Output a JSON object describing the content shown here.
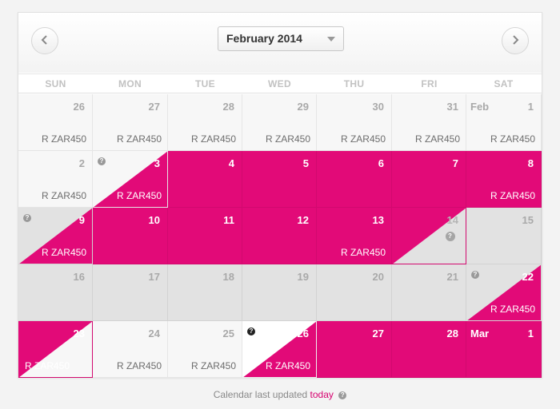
{
  "header": {
    "month_label": "February 2014",
    "prev_icon": "chevron-left-icon",
    "next_icon": "chevron-right-icon"
  },
  "weekdays": [
    "SUN",
    "MON",
    "TUE",
    "WED",
    "THU",
    "FRI",
    "SAT"
  ],
  "colors": {
    "booked": "#e20a78",
    "available": "#f7f7f7",
    "unavailable": "#e2e2e2",
    "muted_text": "#a9a9a9",
    "price_text": "#6d6d6d"
  },
  "days": [
    {
      "day": "26",
      "state": "available",
      "price": "R ZAR450"
    },
    {
      "day": "27",
      "state": "available",
      "price": "R ZAR450"
    },
    {
      "day": "28",
      "state": "available",
      "price": "R ZAR450"
    },
    {
      "day": "29",
      "state": "available",
      "price": "R ZAR450"
    },
    {
      "day": "30",
      "state": "available",
      "price": "R ZAR450"
    },
    {
      "day": "31",
      "state": "available",
      "price": "R ZAR450"
    },
    {
      "day": "1",
      "month": "Feb",
      "state": "available",
      "price": "R ZAR450"
    },
    {
      "day": "2",
      "state": "available",
      "price": "R ZAR450"
    },
    {
      "day": "3",
      "state": "split-available-booked",
      "price": "R ZAR450",
      "info": true
    },
    {
      "day": "4",
      "state": "booked"
    },
    {
      "day": "5",
      "state": "booked"
    },
    {
      "day": "6",
      "state": "booked"
    },
    {
      "day": "7",
      "state": "booked"
    },
    {
      "day": "8",
      "state": "booked",
      "price": "R ZAR450"
    },
    {
      "day": "9",
      "state": "split-unavailable-booked",
      "price": "R ZAR450",
      "info": true
    },
    {
      "day": "10",
      "state": "booked"
    },
    {
      "day": "11",
      "state": "booked"
    },
    {
      "day": "12",
      "state": "booked"
    },
    {
      "day": "13",
      "state": "booked",
      "price": "R ZAR450"
    },
    {
      "day": "14",
      "state": "split-booked-unavailable",
      "info": true,
      "info_center": true
    },
    {
      "day": "15",
      "state": "unavailable"
    },
    {
      "day": "16",
      "state": "unavailable"
    },
    {
      "day": "17",
      "state": "unavailable"
    },
    {
      "day": "18",
      "state": "unavailable"
    },
    {
      "day": "19",
      "state": "unavailable"
    },
    {
      "day": "20",
      "state": "unavailable"
    },
    {
      "day": "21",
      "state": "unavailable"
    },
    {
      "day": "22",
      "state": "split-unavailable-booked",
      "price": "R ZAR450",
      "info": true
    },
    {
      "day": "23",
      "state": "split-booked-available",
      "price": "R ZAR450"
    },
    {
      "day": "24",
      "state": "available",
      "price": "R ZAR450"
    },
    {
      "day": "25",
      "state": "available",
      "price": "R ZAR450"
    },
    {
      "day": "26",
      "state": "split-white-booked",
      "price": "R ZAR450",
      "info": true
    },
    {
      "day": "27",
      "state": "booked"
    },
    {
      "day": "28",
      "state": "booked"
    },
    {
      "day": "1",
      "month": "Mar",
      "state": "booked"
    }
  ],
  "footer": {
    "text": "Calendar last updated",
    "link": "today"
  }
}
